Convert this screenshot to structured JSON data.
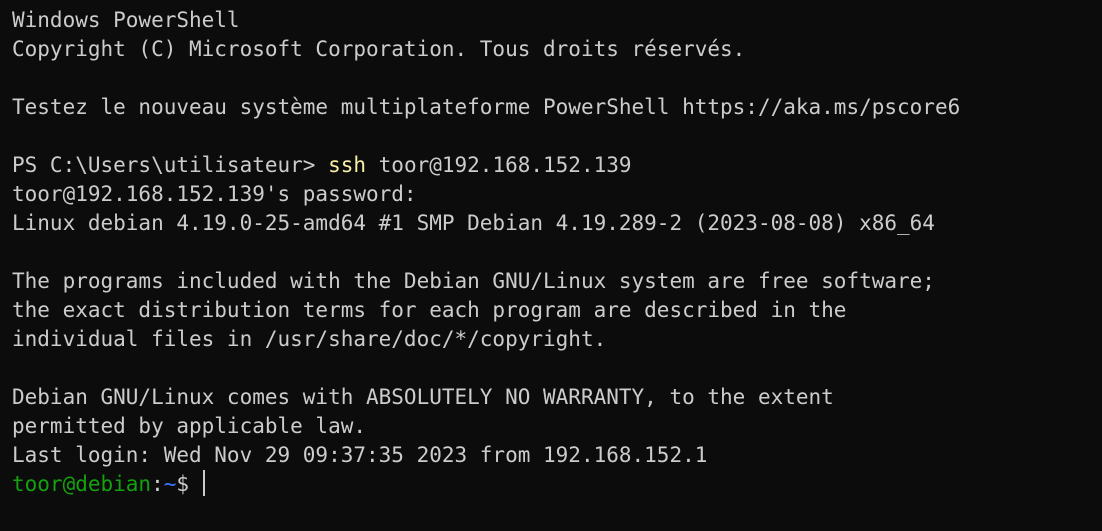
{
  "terminal": {
    "lines": {
      "l0": "Windows PowerShell",
      "l1": "Copyright (C) Microsoft Corporation. Tous droits réservés.",
      "l3": "Testez le nouveau système multiplateforme PowerShell https://aka.ms/pscore6",
      "l5_prompt": "PS C:\\Users\\utilisateur> ",
      "l5_cmd": "ssh",
      "l5_args": " toor@192.168.152.139",
      "l6": "toor@192.168.152.139's password:",
      "l7": "Linux debian 4.19.0-25-amd64 #1 SMP Debian 4.19.289-2 (2023-08-08) x86_64",
      "l9": "The programs included with the Debian GNU/Linux system are free software;",
      "l10": "the exact distribution terms for each program are described in the",
      "l11": "individual files in /usr/share/doc/*/copyright.",
      "l13": "Debian GNU/Linux comes with ABSOLUTELY NO WARRANTY, to the extent",
      "l14": "permitted by applicable law.",
      "l15": "Last login: Wed Nov 29 09:37:35 2023 from 192.168.152.1"
    },
    "prompt": {
      "user_host": "toor@debian",
      "colon": ":",
      "path": "~",
      "symbol": "$"
    },
    "colors": {
      "background": "#0c0c0c",
      "foreground": "#cccccc",
      "command": "#f9f1a5",
      "user_host": "#13a10e",
      "path": "#3b78ff"
    }
  }
}
